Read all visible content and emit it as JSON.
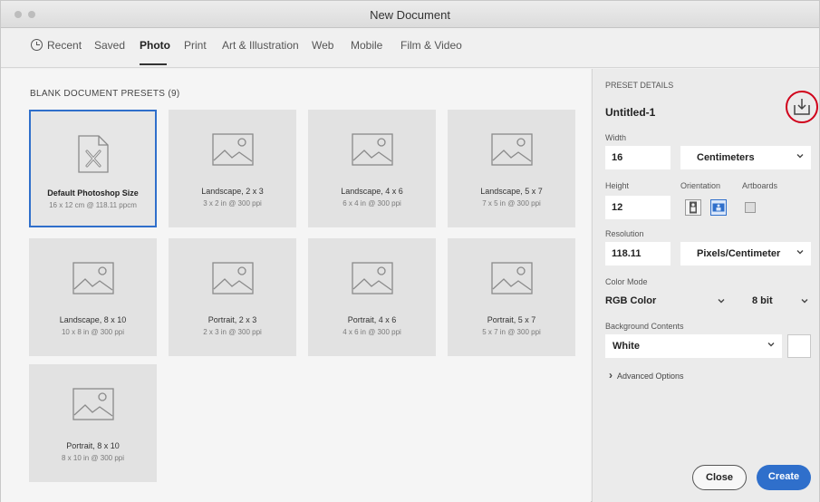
{
  "window": {
    "title": "New Document"
  },
  "tabs": [
    {
      "label": "Recent",
      "active": false
    },
    {
      "label": "Saved",
      "active": false
    },
    {
      "label": "Photo",
      "active": true
    },
    {
      "label": "Print",
      "active": false
    },
    {
      "label": "Art & Illustration",
      "active": false
    },
    {
      "label": "Web",
      "active": false
    },
    {
      "label": "Mobile",
      "active": false
    },
    {
      "label": "Film & Video",
      "active": false
    }
  ],
  "presets": {
    "heading": "BLANK DOCUMENT PRESETS",
    "count": "(9)",
    "items": [
      {
        "name": "Default Photoshop Size",
        "sub": "16 x 12 cm @ 118.11 ppcm",
        "icon": "default-document-icon",
        "selected": true
      },
      {
        "name": "Landscape, 2 x 3",
        "sub": "3 x 2 in @ 300 ppi",
        "icon": "image-placeholder-icon",
        "selected": false
      },
      {
        "name": "Landscape, 4 x 6",
        "sub": "6 x 4 in @ 300 ppi",
        "icon": "image-placeholder-icon",
        "selected": false
      },
      {
        "name": "Landscape, 5 x 7",
        "sub": "7 x 5 in @ 300 ppi",
        "icon": "image-placeholder-icon",
        "selected": false
      },
      {
        "name": "Landscape, 8 x 10",
        "sub": "10 x 8 in @ 300 ppi",
        "icon": "image-placeholder-icon",
        "selected": false
      },
      {
        "name": "Portrait, 2 x 3",
        "sub": "2 x 3 in @ 300 ppi",
        "icon": "image-placeholder-icon",
        "selected": false
      },
      {
        "name": "Portrait, 4 x 6",
        "sub": "4 x 6 in @ 300 ppi",
        "icon": "image-placeholder-icon",
        "selected": false
      },
      {
        "name": "Portrait, 5 x 7",
        "sub": "5 x 7 in @ 300 ppi",
        "icon": "image-placeholder-icon",
        "selected": false
      },
      {
        "name": "Portrait, 8 x 10",
        "sub": "8 x 10 in @ 300 ppi",
        "icon": "image-placeholder-icon",
        "selected": false
      }
    ]
  },
  "details": {
    "heading": "PRESET DETAILS",
    "name": "Untitled-1",
    "save_icon": "save-preset-icon",
    "width_label": "Width",
    "width_value": "16",
    "width_unit": "Centimeters",
    "height_label": "Height",
    "height_value": "12",
    "orientation_label": "Orientation",
    "orientation_selected": "landscape",
    "artboards_label": "Artboards",
    "artboards_checked": false,
    "resolution_label": "Resolution",
    "resolution_value": "118.11",
    "resolution_unit": "Pixels/Centimeter",
    "color_mode_label": "Color Mode",
    "color_mode": "RGB Color",
    "bit_depth": "8 bit",
    "background_label": "Background Contents",
    "background": "White",
    "background_swatch": "#ffffff",
    "advanced": "Advanced Options"
  },
  "buttons": {
    "close": "Close",
    "create": "Create"
  },
  "colors": {
    "accent": "#2f6fcb",
    "highlight_ring": "#d0021b"
  }
}
